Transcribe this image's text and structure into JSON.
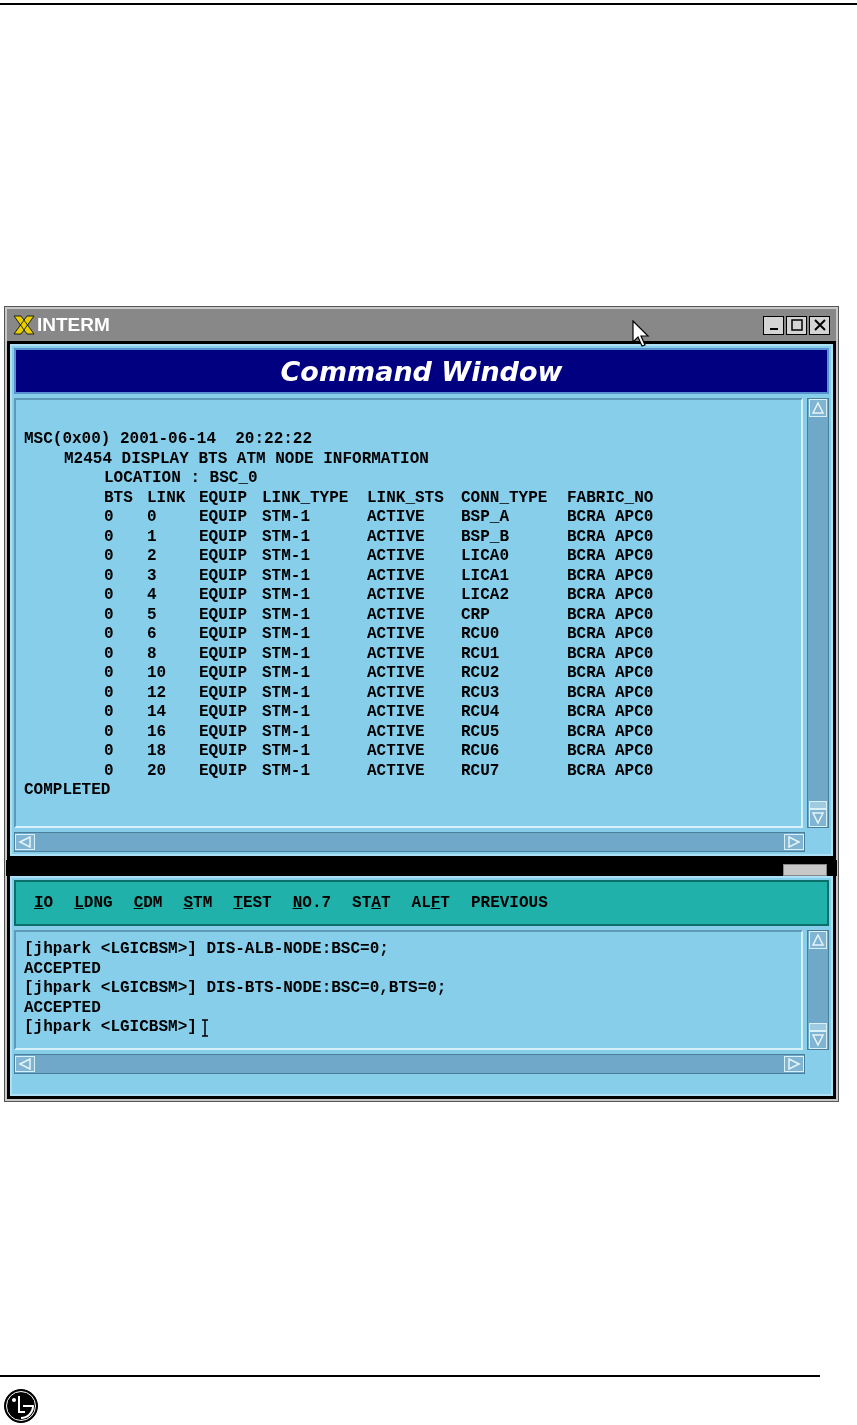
{
  "window": {
    "title": "INTERM",
    "banner": "Command Window"
  },
  "output": {
    "header_lines": [
      "MSC(0x00) 2001-06-14  20:22:22",
      "M2454 DISPLAY BTS ATM NODE INFORMATION",
      "LOCATION : BSC_0"
    ],
    "table": {
      "columns": [
        "BTS",
        "LINK",
        "EQUIP",
        "LINK_TYPE",
        "LINK_STS",
        "CONN_TYPE",
        "FABRIC_NO"
      ],
      "rows": [
        [
          "0",
          "0",
          "EQUIP",
          "STM-1",
          "ACTIVE",
          "BSP_A",
          "BCRA APC0"
        ],
        [
          "0",
          "1",
          "EQUIP",
          "STM-1",
          "ACTIVE",
          "BSP_B",
          "BCRA APC0"
        ],
        [
          "0",
          "2",
          "EQUIP",
          "STM-1",
          "ACTIVE",
          "LICA0",
          "BCRA APC0"
        ],
        [
          "0",
          "3",
          "EQUIP",
          "STM-1",
          "ACTIVE",
          "LICA1",
          "BCRA APC0"
        ],
        [
          "0",
          "4",
          "EQUIP",
          "STM-1",
          "ACTIVE",
          "LICA2",
          "BCRA APC0"
        ],
        [
          "0",
          "5",
          "EQUIP",
          "STM-1",
          "ACTIVE",
          "CRP",
          "BCRA APC0"
        ],
        [
          "0",
          "6",
          "EQUIP",
          "STM-1",
          "ACTIVE",
          "RCU0",
          "BCRA APC0"
        ],
        [
          "0",
          "8",
          "EQUIP",
          "STM-1",
          "ACTIVE",
          "RCU1",
          "BCRA APC0"
        ],
        [
          "0",
          "10",
          "EQUIP",
          "STM-1",
          "ACTIVE",
          "RCU2",
          "BCRA APC0"
        ],
        [
          "0",
          "12",
          "EQUIP",
          "STM-1",
          "ACTIVE",
          "RCU3",
          "BCRA APC0"
        ],
        [
          "0",
          "14",
          "EQUIP",
          "STM-1",
          "ACTIVE",
          "RCU4",
          "BCRA APC0"
        ],
        [
          "0",
          "16",
          "EQUIP",
          "STM-1",
          "ACTIVE",
          "RCU5",
          "BCRA APC0"
        ],
        [
          "0",
          "18",
          "EQUIP",
          "STM-1",
          "ACTIVE",
          "RCU6",
          "BCRA APC0"
        ],
        [
          "0",
          "20",
          "EQUIP",
          "STM-1",
          "ACTIVE",
          "RCU7",
          "BCRA APC0"
        ]
      ]
    },
    "footer_line": "COMPLETED"
  },
  "menu": [
    {
      "key": "I",
      "after": "O"
    },
    {
      "key": "L",
      "after": "DNG"
    },
    {
      "key": "C",
      "after": "DM"
    },
    {
      "key": "S",
      "after": "TM"
    },
    {
      "key": "T",
      "after": "EST"
    },
    {
      "key": "N",
      "after": "O.7"
    },
    {
      "before": "ST",
      "key": "A",
      "after": "T"
    },
    {
      "before": "AL",
      "key": "F",
      "after": "T"
    },
    {
      "before": "PREVIOUS"
    }
  ],
  "console": {
    "lines": [
      "[jhpark <LGICBSM>] DIS-ALB-NODE:BSC=0;",
      "ACCEPTED",
      "[jhpark <LGICBSM>] DIS-BTS-NODE:BSC=0,BTS=0;",
      "ACCEPTED"
    ],
    "prompt": "[jhpark <LGICBSM>]"
  }
}
